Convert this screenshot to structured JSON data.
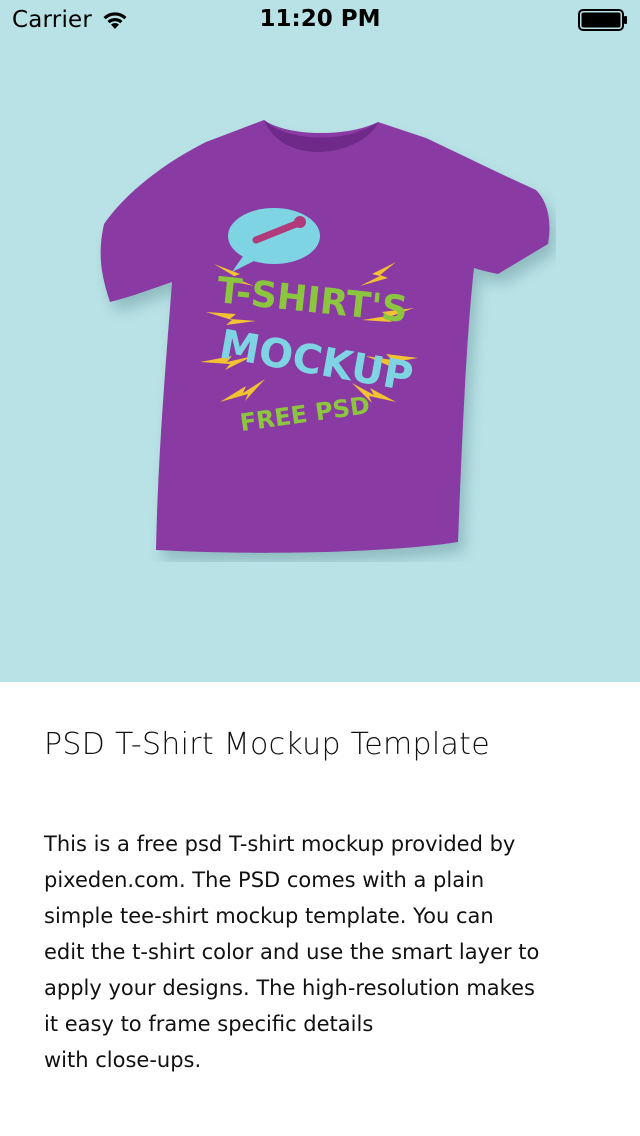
{
  "status_bar": {
    "carrier": "Carrier",
    "time": "11:20 PM",
    "icons": [
      "wifi-icon",
      "battery-icon"
    ]
  },
  "hero": {
    "background_color": "#b9e2e6",
    "shirt_color": "#8a3aa3",
    "graphic_lines": [
      "T-SHIRT'S",
      "MOCKUP",
      "FREE PSD"
    ]
  },
  "article": {
    "title": "PSD T-Shirt Mockup Template",
    "description_lines": [
      "This is a free psd T-shirt mockup provided by",
      "pixeden.com. The PSD comes with a plain",
      "simple tee-shirt mockup template. You can",
      "edit the t-shirt color and use the smart layer to",
      "apply your designs. The high-resolution makes",
      "it easy to frame specific details",
      "with close-ups."
    ]
  }
}
